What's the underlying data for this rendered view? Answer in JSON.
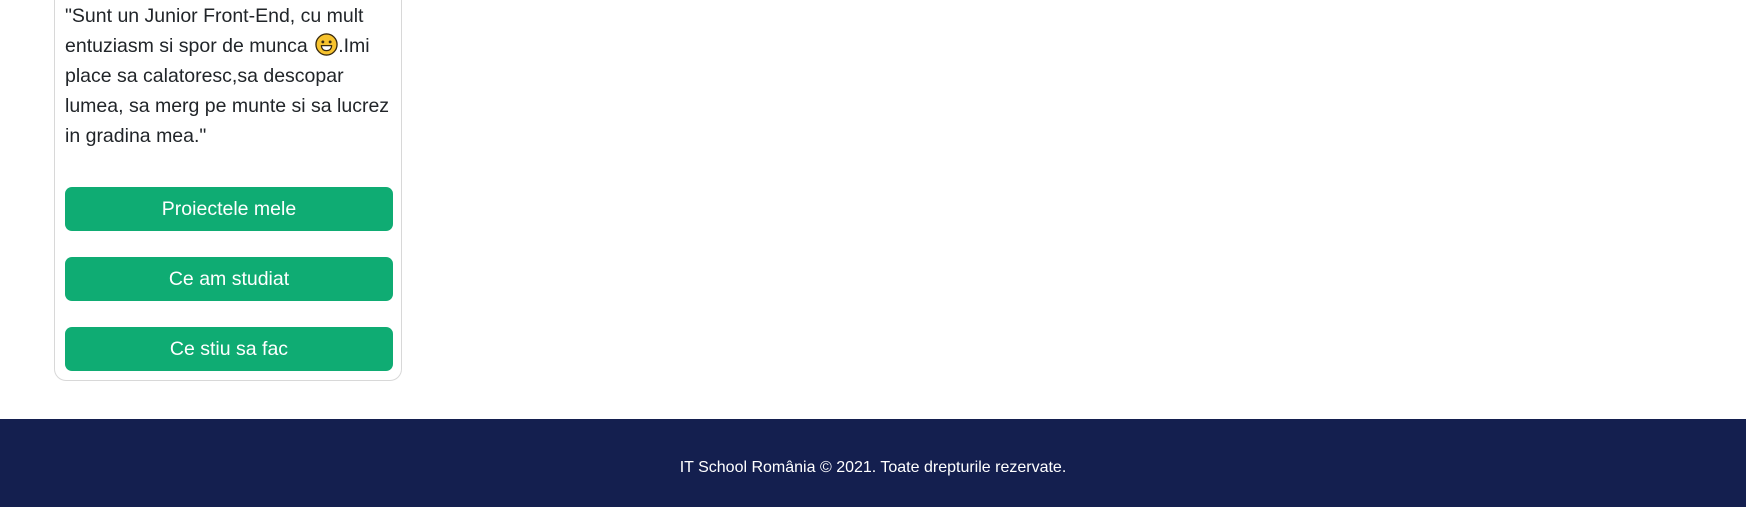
{
  "profile": {
    "quote_start": "\"Sunt un Junior Front-End, cu mult entuziasm si spor de munca ",
    "quote_emoji": "grinning-face-emoji",
    "quote_end": ".Imi place sa calatoresc,sa descopar lumea, sa merg pe munte si sa lucrez in gradina mea.\""
  },
  "buttons": {
    "projects_label": "Proiectele mele",
    "studied_label": "Ce am studiat",
    "skills_label": "Ce stiu sa fac"
  },
  "footer": {
    "copyright": "IT School România © 2021. Toate drepturile rezervate."
  },
  "colors": {
    "button_green": "#0fac73",
    "footer_navy": "#141f4f"
  }
}
